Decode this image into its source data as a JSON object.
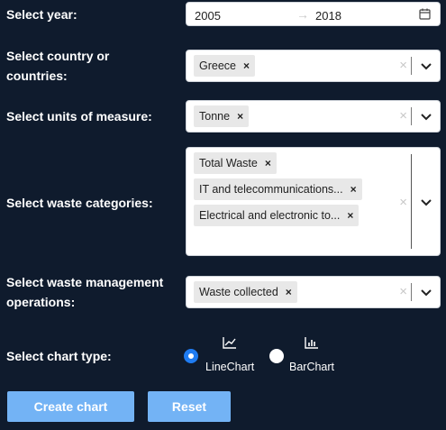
{
  "year": {
    "label": "Select year:",
    "from": "2005",
    "to": "2018",
    "arrow": "→",
    "icon": "calendar-icon"
  },
  "country": {
    "label_line1": "Select country or",
    "label_line2": "countries:",
    "tags": [
      "Greece"
    ]
  },
  "units": {
    "label": "Select units of measure:",
    "tags": [
      "Tonne"
    ]
  },
  "waste_categories": {
    "label": "Select waste categories:",
    "tags": [
      "Total Waste",
      "IT and telecommunications...",
      "Electrical and electronic to..."
    ]
  },
  "operations": {
    "label_line1": "Select waste management",
    "label_line2": "operations:",
    "tags": [
      "Waste collected"
    ]
  },
  "chart_type": {
    "label": "Select chart type:",
    "options": [
      {
        "label": "LineChart",
        "icon": "line-chart-icon",
        "selected": true
      },
      {
        "label": "BarChart",
        "icon": "bar-chart-icon",
        "selected": false
      }
    ]
  },
  "remove_glyph": "×",
  "buttons": {
    "create": "Create chart",
    "reset": "Reset"
  },
  "colors": {
    "background": "#0f1b2d",
    "accent": "#1f7cf2",
    "button": "#73b3f5"
  }
}
